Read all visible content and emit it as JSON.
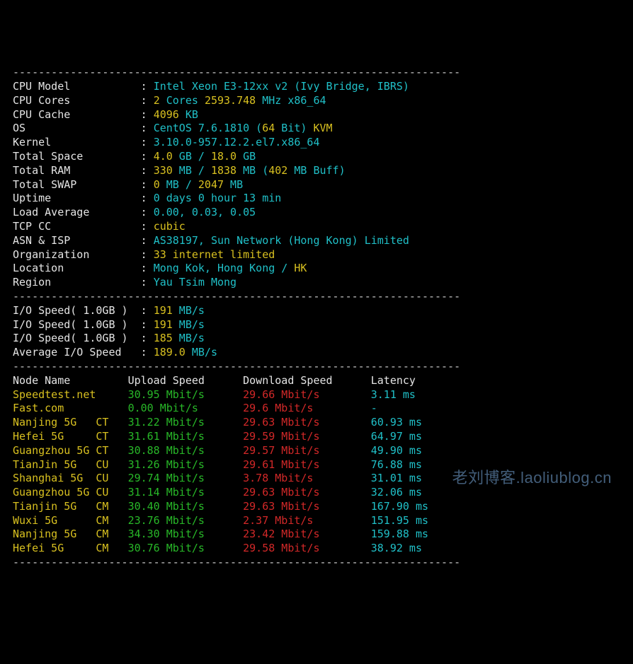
{
  "div": "----------------------------------------------------------------------",
  "sys": {
    "rows": [
      {
        "label": "CPU Model",
        "segs": [
          [
            "cyan",
            "Intel Xeon E3-12xx v2 (Ivy Bridge, IBRS)"
          ]
        ]
      },
      {
        "label": "CPU Cores",
        "segs": [
          [
            "yellow",
            "2"
          ],
          [
            "cyan",
            " Cores "
          ],
          [
            "yellow",
            "2593.748"
          ],
          [
            "cyan",
            " MHz x86_64"
          ]
        ]
      },
      {
        "label": "CPU Cache",
        "segs": [
          [
            "yellow",
            "4096"
          ],
          [
            "cyan",
            " KB"
          ]
        ]
      },
      {
        "label": "OS",
        "segs": [
          [
            "cyan",
            "CentOS 7.6.1810 ("
          ],
          [
            "yellow",
            "64"
          ],
          [
            "cyan",
            " Bit) "
          ],
          [
            "yellow",
            "KVM"
          ]
        ]
      },
      {
        "label": "Kernel",
        "segs": [
          [
            "cyan",
            "3.10.0-957.12.2.el7.x86_64"
          ]
        ]
      },
      {
        "label": "Total Space",
        "segs": [
          [
            "yellow",
            "4.0"
          ],
          [
            "cyan",
            " GB / "
          ],
          [
            "yellow",
            "18.0"
          ],
          [
            "cyan",
            " GB"
          ]
        ]
      },
      {
        "label": "Total RAM",
        "segs": [
          [
            "yellow",
            "330"
          ],
          [
            "cyan",
            " MB / "
          ],
          [
            "yellow",
            "1838"
          ],
          [
            "cyan",
            " MB ("
          ],
          [
            "yellow",
            "402"
          ],
          [
            "cyan",
            " MB Buff)"
          ]
        ]
      },
      {
        "label": "Total SWAP",
        "segs": [
          [
            "yellow",
            "0"
          ],
          [
            "cyan",
            " MB / "
          ],
          [
            "yellow",
            "2047"
          ],
          [
            "cyan",
            " MB"
          ]
        ]
      },
      {
        "label": "Uptime",
        "segs": [
          [
            "cyan",
            "0 days 0 hour 13 min"
          ]
        ]
      },
      {
        "label": "Load Average",
        "segs": [
          [
            "cyan",
            "0.00, 0.03, 0.05"
          ]
        ]
      },
      {
        "label": "TCP CC",
        "segs": [
          [
            "yellow",
            "cubic"
          ]
        ]
      },
      {
        "label": "ASN & ISP",
        "segs": [
          [
            "cyan",
            "AS38197, Sun Network (Hong Kong) Limited"
          ]
        ]
      },
      {
        "label": "Organization",
        "segs": [
          [
            "yellow",
            "33 internet limited"
          ]
        ]
      },
      {
        "label": "Location",
        "segs": [
          [
            "cyan",
            "Mong Kok, Hong Kong / "
          ],
          [
            "yellow",
            "HK"
          ]
        ]
      },
      {
        "label": "Region",
        "segs": [
          [
            "cyan",
            "Yau Tsim Mong"
          ]
        ]
      }
    ]
  },
  "io": {
    "rows": [
      {
        "label": "I/O Speed( 1.0GB )",
        "segs": [
          [
            "yellow",
            "191"
          ],
          [
            "cyan",
            " MB/s"
          ]
        ]
      },
      {
        "label": "I/O Speed( 1.0GB )",
        "segs": [
          [
            "yellow",
            "191"
          ],
          [
            "cyan",
            " MB/s"
          ]
        ]
      },
      {
        "label": "I/O Speed( 1.0GB )",
        "segs": [
          [
            "yellow",
            "185"
          ],
          [
            "cyan",
            " MB/s"
          ]
        ]
      },
      {
        "label": "Average I/O Speed",
        "segs": [
          [
            "yellow",
            "189.0"
          ],
          [
            "cyan",
            " MB/s"
          ]
        ]
      }
    ]
  },
  "speed": {
    "header": {
      "node": "Node Name",
      "up": "Upload Speed",
      "down": "Download Speed",
      "lat": "Latency"
    },
    "rows": [
      {
        "node": "Speedtest.net",
        "up": "30.95 Mbit/s",
        "down": "29.66 Mbit/s",
        "lat": "3.11 ms"
      },
      {
        "node": "Fast.com",
        "up": "0.00 Mbit/s",
        "down": "29.6 Mbit/s",
        "lat": "-"
      },
      {
        "node": "Nanjing 5G   CT",
        "up": "31.22 Mbit/s",
        "down": "29.63 Mbit/s",
        "lat": "60.93 ms"
      },
      {
        "node": "Hefei 5G     CT",
        "up": "31.61 Mbit/s",
        "down": "29.59 Mbit/s",
        "lat": "64.97 ms"
      },
      {
        "node": "Guangzhou 5G CT",
        "up": "30.88 Mbit/s",
        "down": "29.57 Mbit/s",
        "lat": "49.90 ms"
      },
      {
        "node": "TianJin 5G   CU",
        "up": "31.26 Mbit/s",
        "down": "29.61 Mbit/s",
        "lat": "76.88 ms"
      },
      {
        "node": "Shanghai 5G  CU",
        "up": "29.74 Mbit/s",
        "down": "3.78 Mbit/s",
        "lat": "31.01 ms"
      },
      {
        "node": "Guangzhou 5G CU",
        "up": "31.14 Mbit/s",
        "down": "29.63 Mbit/s",
        "lat": "32.06 ms"
      },
      {
        "node": "Tianjin 5G   CM",
        "up": "30.40 Mbit/s",
        "down": "29.63 Mbit/s",
        "lat": "167.90 ms"
      },
      {
        "node": "Wuxi 5G      CM",
        "up": "23.76 Mbit/s",
        "down": "2.37 Mbit/s",
        "lat": "151.95 ms"
      },
      {
        "node": "Nanjing 5G   CM",
        "up": "34.30 Mbit/s",
        "down": "23.42 Mbit/s",
        "lat": "159.88 ms"
      },
      {
        "node": "Hefei 5G     CM",
        "up": "30.76 Mbit/s",
        "down": "29.58 Mbit/s",
        "lat": "38.92 ms"
      }
    ]
  },
  "watermark": "老刘博客.laoliublog.cn"
}
